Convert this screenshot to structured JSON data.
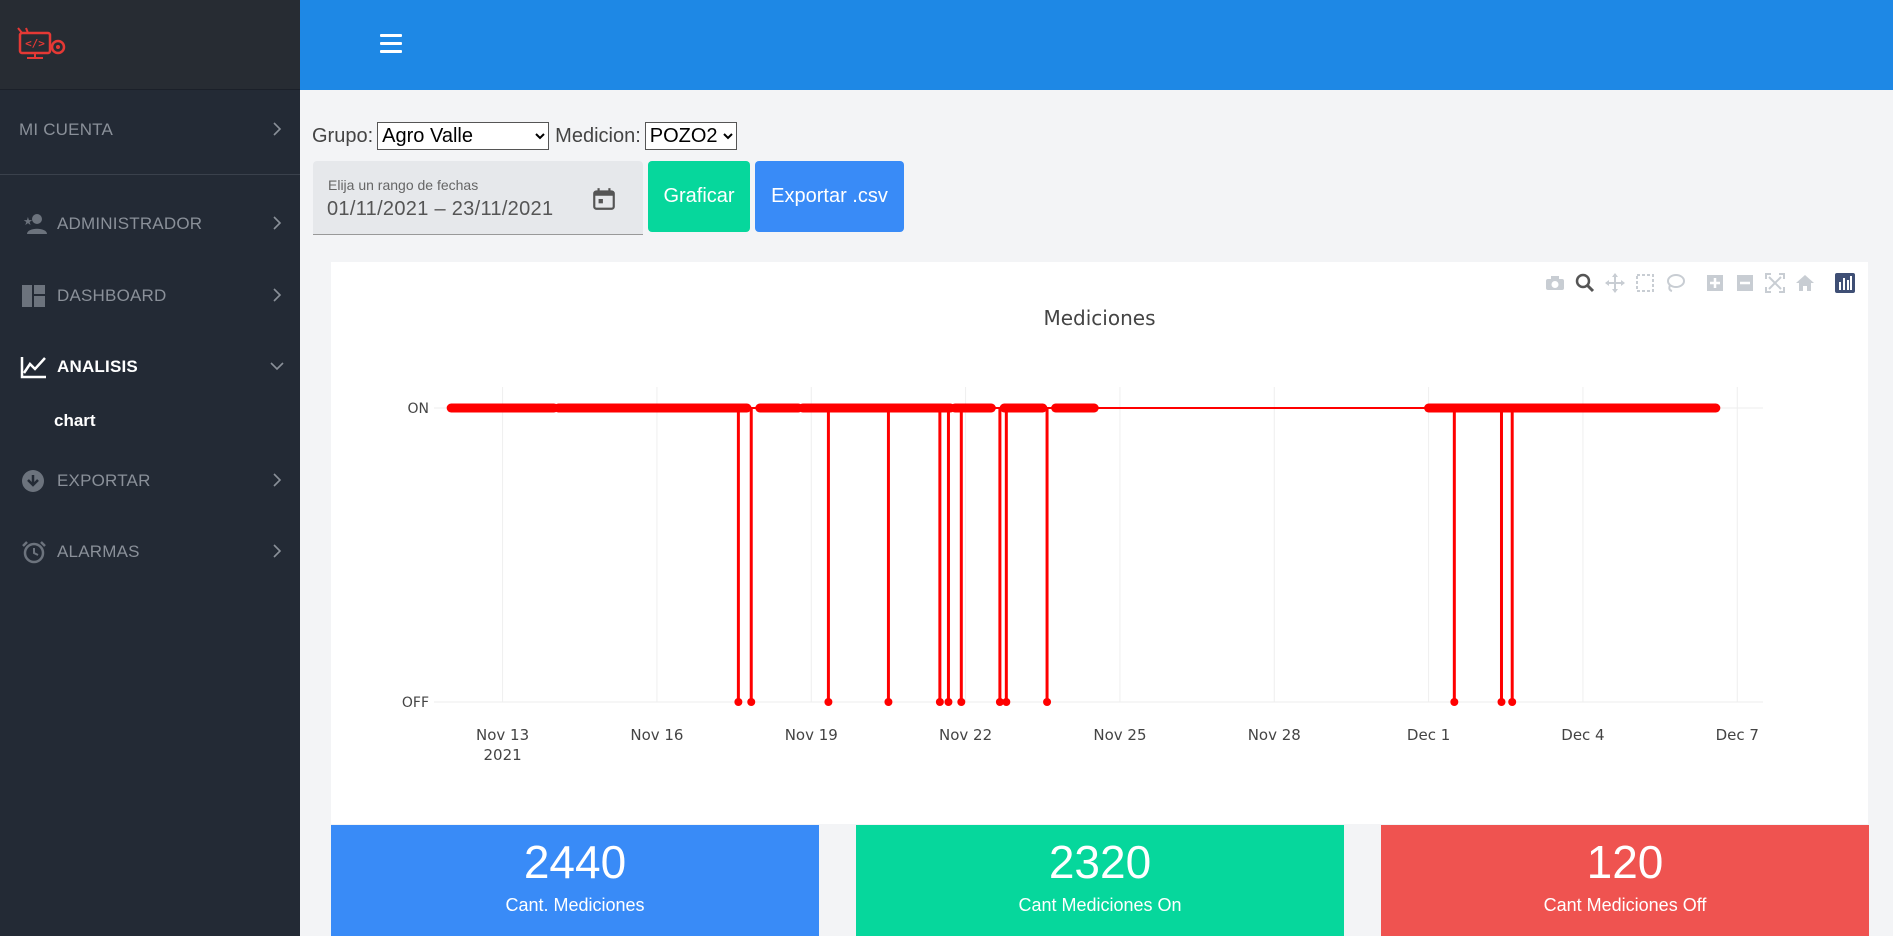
{
  "sidebar": {
    "items": [
      {
        "label": "MI CUENTA"
      },
      {
        "label": "ADMINISTRADOR"
      },
      {
        "label": "DASHBOARD"
      },
      {
        "label": "ANALISIS"
      },
      {
        "label": "EXPORTAR"
      },
      {
        "label": "ALARMAS"
      }
    ],
    "sub_item": "chart"
  },
  "controls": {
    "grupo_label": "Grupo:",
    "grupo_value": "Agro Valle",
    "medicion_label": "Medicion:",
    "medicion_value": "POZO2",
    "date_label": "Elija un rango de fechas",
    "date_value": "01/11/2021 – 23/11/2021",
    "graficar": "Graficar",
    "exportar": "Exportar .csv"
  },
  "chart_data": {
    "type": "line",
    "title": "Mediciones",
    "xlabel": "",
    "ylabel": "",
    "y_categories": [
      "OFF",
      "ON"
    ],
    "x_ticks": [
      "Nov 13\n2021",
      "Nov 16",
      "Nov 19",
      "Nov 22",
      "Nov 25",
      "Nov 28",
      "Dec 1",
      "Dec 4",
      "Dec 7"
    ],
    "x_range": [
      "2021-11-11T16:00",
      "2021-12-07T12:00"
    ],
    "series": [
      {
        "color": "#ff0000",
        "on_segments": [
          [
            "2021-11-12T00:00",
            "2021-11-14T00:00"
          ],
          [
            "2021-11-14T02:00",
            "2021-11-17T18:00"
          ],
          [
            "2021-11-18T00:00",
            "2021-11-18T18:00"
          ],
          [
            "2021-11-18T20:00",
            "2021-11-21T17:00"
          ],
          [
            "2021-11-21T19:00",
            "2021-11-22T12:00"
          ],
          [
            "2021-11-22T18:00",
            "2021-11-23T12:00"
          ],
          [
            "2021-11-23T18:00",
            "2021-11-24T12:00"
          ],
          [
            "2021-12-01T00:00",
            "2021-12-06T14:00"
          ]
        ],
        "off_drops": [
          "2021-11-17T14:00",
          "2021-11-17T20:00",
          "2021-11-19T08:00",
          "2021-11-20T12:00",
          "2021-11-21T12:00",
          "2021-11-21T16:00",
          "2021-11-21T22:00",
          "2021-11-22T16:00",
          "2021-11-22T19:00",
          "2021-11-23T14:00",
          "2021-12-01T12:00",
          "2021-12-02T10:00",
          "2021-12-02T15:00"
        ]
      }
    ],
    "grid": true
  },
  "stats": {
    "total": "2440",
    "total_label": "Cant. Mediciones",
    "on": "2320",
    "on_label": "Cant Mediciones On",
    "off": "120",
    "off_label": "Cant Mediciones Off"
  },
  "colors": {
    "topbar": "#1e88e5",
    "sidebar": "#232a35",
    "green": "#06d79c",
    "blue": "#398bf7",
    "red": "#ef5350"
  }
}
